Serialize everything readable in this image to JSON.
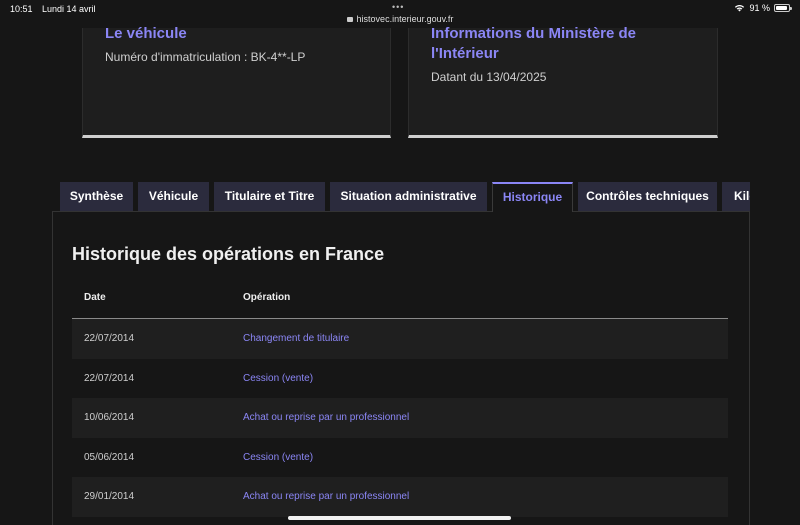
{
  "status_bar": {
    "time": "10:51",
    "date": "Lundi 14 avril",
    "dots": "•••",
    "url": "histovec.interieur.gouv.fr",
    "battery": "91 %",
    "battery_level": 0.91
  },
  "cards": {
    "left": {
      "title": "Le véhicule",
      "subtitle": "Numéro d'immatriculation : BK-4**-LP"
    },
    "right": {
      "title_line1": "Informations du Ministère de",
      "title_line2": "l'Intérieur",
      "subtitle": "Datant du 13/04/2025"
    }
  },
  "tabs": [
    {
      "label": "Synthèse"
    },
    {
      "label": "Véhicule"
    },
    {
      "label": "Titulaire et Titre"
    },
    {
      "label": "Situation administrative"
    },
    {
      "label": "Historique"
    },
    {
      "label": "Contrôles techniques"
    },
    {
      "label": "Kilo"
    }
  ],
  "active_tab": "Historique",
  "history": {
    "title": "Historique des opérations en France",
    "columns": {
      "date": "Date",
      "operation": "Opération"
    },
    "rows": [
      {
        "date": "22/07/2014",
        "operation": "Changement de titulaire"
      },
      {
        "date": "22/07/2014",
        "operation": "Cession (vente)"
      },
      {
        "date": "10/06/2014",
        "operation": "Achat ou reprise par un professionnel"
      },
      {
        "date": "05/06/2014",
        "operation": "Cession (vente)"
      },
      {
        "date": "29/01/2014",
        "operation": "Achat ou reprise par un professionnel"
      }
    ]
  },
  "colors": {
    "accent": "#8b86f5",
    "background": "#161616",
    "tab_bg": "#2b2b3d"
  }
}
